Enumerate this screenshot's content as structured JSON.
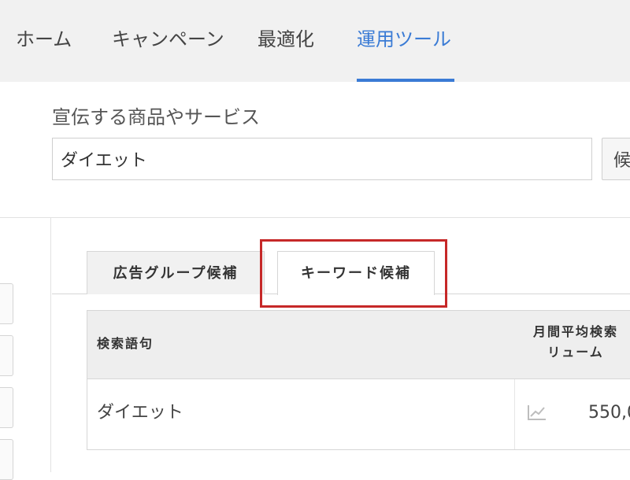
{
  "nav": {
    "items": [
      {
        "label": "ホーム"
      },
      {
        "label": "キャンペーン"
      },
      {
        "label": "最適化"
      },
      {
        "label": "運用ツール"
      }
    ]
  },
  "form": {
    "product_label": "宣伝する商品やサービス",
    "product_value": "ダイエット",
    "suggest_button_label": "候"
  },
  "tabs": [
    {
      "label": "広告グループ候補"
    },
    {
      "label": "キーワード候補"
    }
  ],
  "table": {
    "headers": {
      "keyword": "検索語句",
      "volume": "月間平均検索\nリューム"
    },
    "rows": [
      {
        "keyword": "ダイエット",
        "volume": "550,0"
      }
    ]
  },
  "colors": {
    "accent": "#3a7bd5",
    "highlight": "#c62828"
  }
}
